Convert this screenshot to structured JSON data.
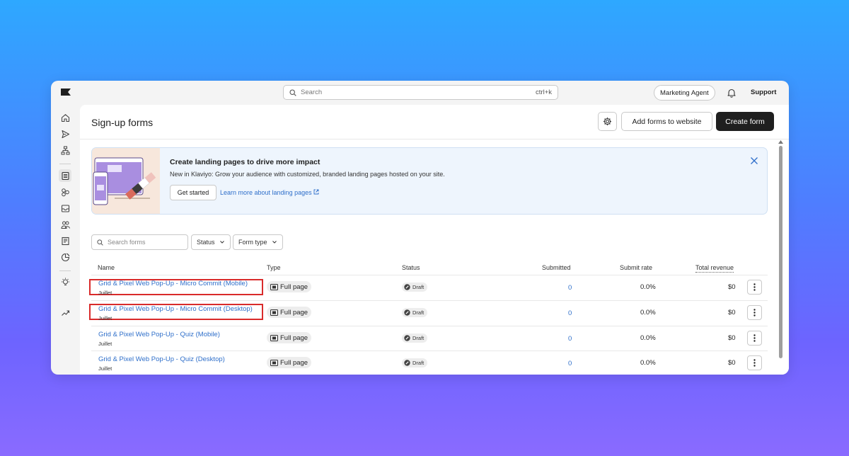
{
  "topbar": {
    "search_placeholder": "Search",
    "search_shortcut": "ctrl+k",
    "agent_label": "Marketing Agent",
    "support_label": "Support"
  },
  "sidebar": {
    "icons": [
      "home-icon",
      "send-icon",
      "flow-icon",
      "forms-icon",
      "segments-icon",
      "inbox-icon",
      "audience-icon",
      "content-icon",
      "analytics-icon",
      "ideas-icon",
      "trend-icon"
    ],
    "active": "forms-icon"
  },
  "page": {
    "title": "Sign-up forms",
    "add_forms_label": "Add forms to website",
    "create_form_label": "Create form"
  },
  "banner": {
    "title": "Create landing pages to drive more impact",
    "subtitle": "New in Klaviyo: Grow your audience with customized, branded landing pages hosted on your site.",
    "get_started_label": "Get started",
    "learn_more_label": "Learn more about landing pages"
  },
  "filters": {
    "search_placeholder": "Search forms",
    "status_label": "Status",
    "form_type_label": "Form type"
  },
  "table": {
    "headers": {
      "name": "Name",
      "type": "Type",
      "status": "Status",
      "submitted": "Submitted",
      "submit_rate": "Submit rate",
      "total_revenue": "Total revenue"
    },
    "rows": [
      {
        "name": "Grid & Pixel Web Pop-Up - Micro Commit (Mobile)",
        "sub": "Juillet",
        "type": "Full page",
        "status": "Draft",
        "submitted": "0",
        "rate": "0.0%",
        "revenue": "$0",
        "highlighted": true
      },
      {
        "name": "Grid & Pixel Web Pop-Up - Micro Commit (Desktop)",
        "sub": "Juillet",
        "type": "Full page",
        "status": "Draft",
        "submitted": "0",
        "rate": "0.0%",
        "revenue": "$0",
        "highlighted": true
      },
      {
        "name": "Grid & Pixel Web Pop-Up - Quiz (Mobile)",
        "sub": "Juillet",
        "type": "Full page",
        "status": "Draft",
        "submitted": "0",
        "rate": "0.0%",
        "revenue": "$0",
        "highlighted": false
      },
      {
        "name": "Grid & Pixel Web Pop-Up - Quiz (Desktop)",
        "sub": "Juillet",
        "type": "Full page",
        "status": "Draft",
        "submitted": "0",
        "rate": "0.0%",
        "revenue": "$0",
        "highlighted": false
      }
    ]
  },
  "colors": {
    "link": "#2f6fca",
    "primary_button": "#1f1f1f",
    "highlight_box": "#d92b2b",
    "banner_bg": "#eef5fd"
  }
}
